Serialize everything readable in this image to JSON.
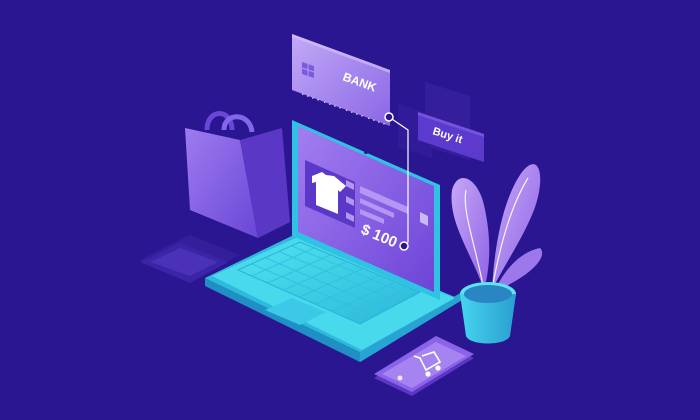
{
  "card": {
    "bank_label": "BANK",
    "number_groups": [
      "....",
      "....",
      "....",
      "...."
    ]
  },
  "buy_button": {
    "label": "Buy it"
  },
  "product": {
    "price": "$ 100"
  },
  "colors": {
    "background": "#2a1690",
    "laptop": "#3fd6e6",
    "screen": "#8a63e8",
    "card": "#a98df0",
    "bag": "#7a58e0",
    "plant_leaf": "#b08bf0",
    "pot": "#3fc8e6",
    "phone": "#8a63e8"
  },
  "icons": [
    "shopping-bag-icon",
    "credit-card-chip-icon",
    "t-shirt-icon",
    "shopping-cart-icon",
    "plant-icon"
  ]
}
